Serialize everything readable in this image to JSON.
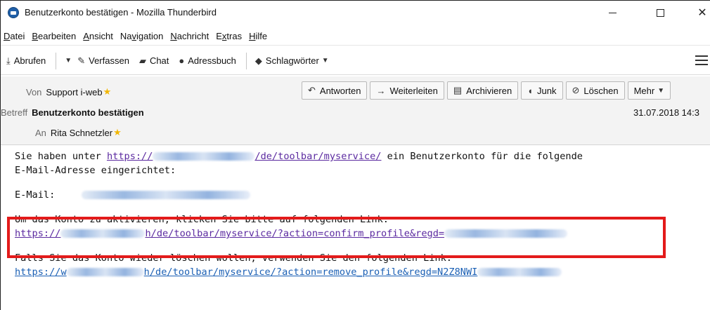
{
  "window": {
    "title": "Benutzerkonto bestätigen - Mozilla Thunderbird",
    "controls": {
      "minimize": "—",
      "maximize": "☐",
      "close": "✕"
    }
  },
  "menu": [
    {
      "pre": "",
      "key": "D",
      "post": "atei"
    },
    {
      "pre": "",
      "key": "B",
      "post": "earbeiten"
    },
    {
      "pre": "",
      "key": "A",
      "post": "nsicht"
    },
    {
      "pre": "Na",
      "key": "v",
      "post": "igation"
    },
    {
      "pre": "",
      "key": "N",
      "post": "achricht"
    },
    {
      "pre": "E",
      "key": "x",
      "post": "tras"
    },
    {
      "pre": "",
      "key": "H",
      "post": "ilfe"
    }
  ],
  "toolbar": {
    "get_messages": "Abrufen",
    "write": "Verfassen",
    "chat": "Chat",
    "address_book": "Adressbuch",
    "tags": "Schlagwörter"
  },
  "header": {
    "from_label": "Von",
    "from_value": "Support i-web",
    "subject_label": "Betreff",
    "subject_value": "Benutzerkonto bestätigen",
    "to_label": "An",
    "to_value": "Rita Schnetzler",
    "date": "31.07.2018 14:3",
    "actions": {
      "reply": "Antworten",
      "forward": "Weiterleiten",
      "archive": "Archivieren",
      "junk": "Junk",
      "delete": "Löschen",
      "more": "Mehr"
    }
  },
  "body": {
    "p1_pre": "Sie haben unter ",
    "p1_link_start": "https://",
    "p1_link_end": "/de/toolbar/myservice/",
    "p1_post": " ein Benutzerkonto für die folgende",
    "p1_line2": "E-Mail-Adresse eingerichtet:",
    "email_label": "E-Mail:",
    "p3_line1": "Um das Konto zu aktivieren, klicken Sie bitte auf folgenden Link:",
    "p3_link_start": "https://",
    "p3_link_mid": "h/de/toolbar/myservice/?action=confirm_profile&regd=",
    "p4_line1": "Falls Sie das Konto wieder löschen wollen, verwenden Sie den folgenden Link:",
    "p4_link_start": "https://w",
    "p4_link_mid": "h/de/toolbar/myservice/?action=remove_profile&regd=N2Z8NWI"
  },
  "colors": {
    "highlight": "#e31b1b",
    "link": "#5b2aa0",
    "link_alt": "#1a5fb4",
    "star": "#f2b705"
  }
}
